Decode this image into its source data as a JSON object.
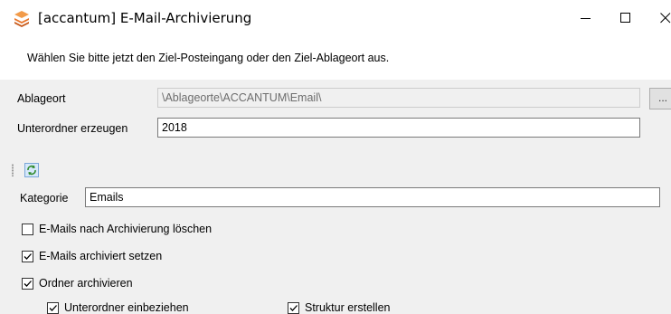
{
  "window": {
    "title": "[accantum] E-Mail-Archivierung",
    "app_icon": "stack-icon",
    "controls": [
      "minimize-icon",
      "maximize-icon",
      "close-icon"
    ]
  },
  "instruction": "Wählen Sie bitte jetzt den Ziel-Posteingang oder den Ziel-Ablageort aus.",
  "form": {
    "ablageort_label": "Ablageort",
    "ablageort_value": "\\Ablageorte\\ACCANTUM\\Email\\",
    "browse_label": "...",
    "unterordner_label": "Unterordner erzeugen",
    "unterordner_value": "2018"
  },
  "toolbar": {
    "refresh_icon": "refresh-icon"
  },
  "kategorie": {
    "label": "Kategorie",
    "value": "Emails"
  },
  "options": [
    {
      "label": "E-Mails nach Archivierung löschen",
      "checked": false
    },
    {
      "label": "E-Mails archiviert setzen",
      "checked": true
    },
    {
      "label": "Ordner archivieren",
      "checked": true
    },
    {
      "label": "Unterordner einbeziehen",
      "checked": true
    },
    {
      "label": "Struktur erstellen",
      "checked": true
    }
  ],
  "colors": {
    "content_bg": "#f0f0f0",
    "border": "#7a7a7a",
    "icon_orange": "#e8742a"
  }
}
